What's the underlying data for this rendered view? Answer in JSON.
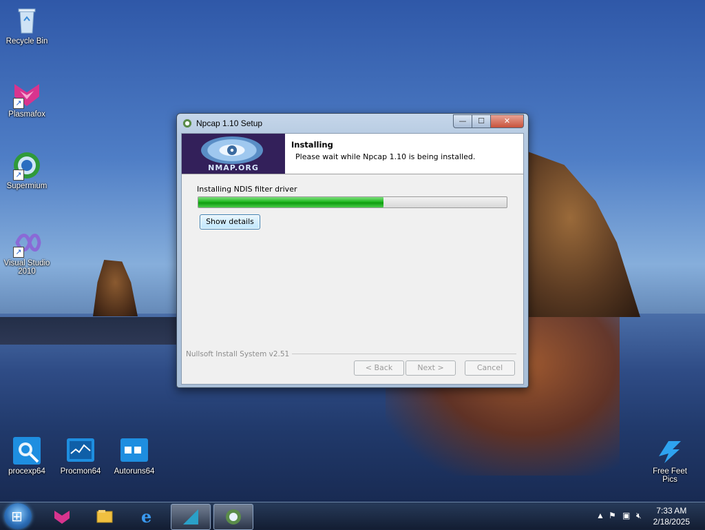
{
  "desktop": {
    "icons": [
      {
        "label": "Recycle Bin",
        "icon": "recycle-bin-icon"
      },
      {
        "label": "Plasmafox",
        "icon": "plasmafox-icon"
      },
      {
        "label": "Supermium",
        "icon": "supermium-icon"
      },
      {
        "label": "Visual Studio 2010",
        "icon": "visual-studio-icon"
      },
      {
        "label": "procexp64",
        "icon": "procexp-icon"
      },
      {
        "label": "Procmon64",
        "icon": "procmon-icon"
      },
      {
        "label": "Autoruns64",
        "icon": "autoruns-icon"
      },
      {
        "label": "Free Feet Pics",
        "icon": "free-feet-pics-icon"
      }
    ]
  },
  "window": {
    "title": "Npcap 1.10 Setup",
    "controls": {
      "minimize": "—",
      "maximize": "☐",
      "close": "✕"
    },
    "banner_text": "NMAP.ORG",
    "header_title": "Installing",
    "header_subtitle": "Please wait while Npcap 1.10 is being installed.",
    "status_text": "Installing NDIS filter driver",
    "progress_percent": 60,
    "show_details_label": "Show details",
    "branding": "Nullsoft Install System v2.51",
    "buttons": {
      "back": "< Back",
      "next": "Next >",
      "cancel": "Cancel"
    }
  },
  "taskbar": {
    "time": "7:33 AM",
    "date": "2/18/2025",
    "tray_chevron": "▲",
    "pinned": [
      "start-button",
      "plasmafox-icon",
      "file-explorer-icon",
      "internet-explorer-icon",
      "app-icon",
      "npcap-setup-icon"
    ]
  },
  "colors": {
    "progress": "#21b821",
    "banner": "#33205a",
    "close_button": "#c8523c"
  }
}
